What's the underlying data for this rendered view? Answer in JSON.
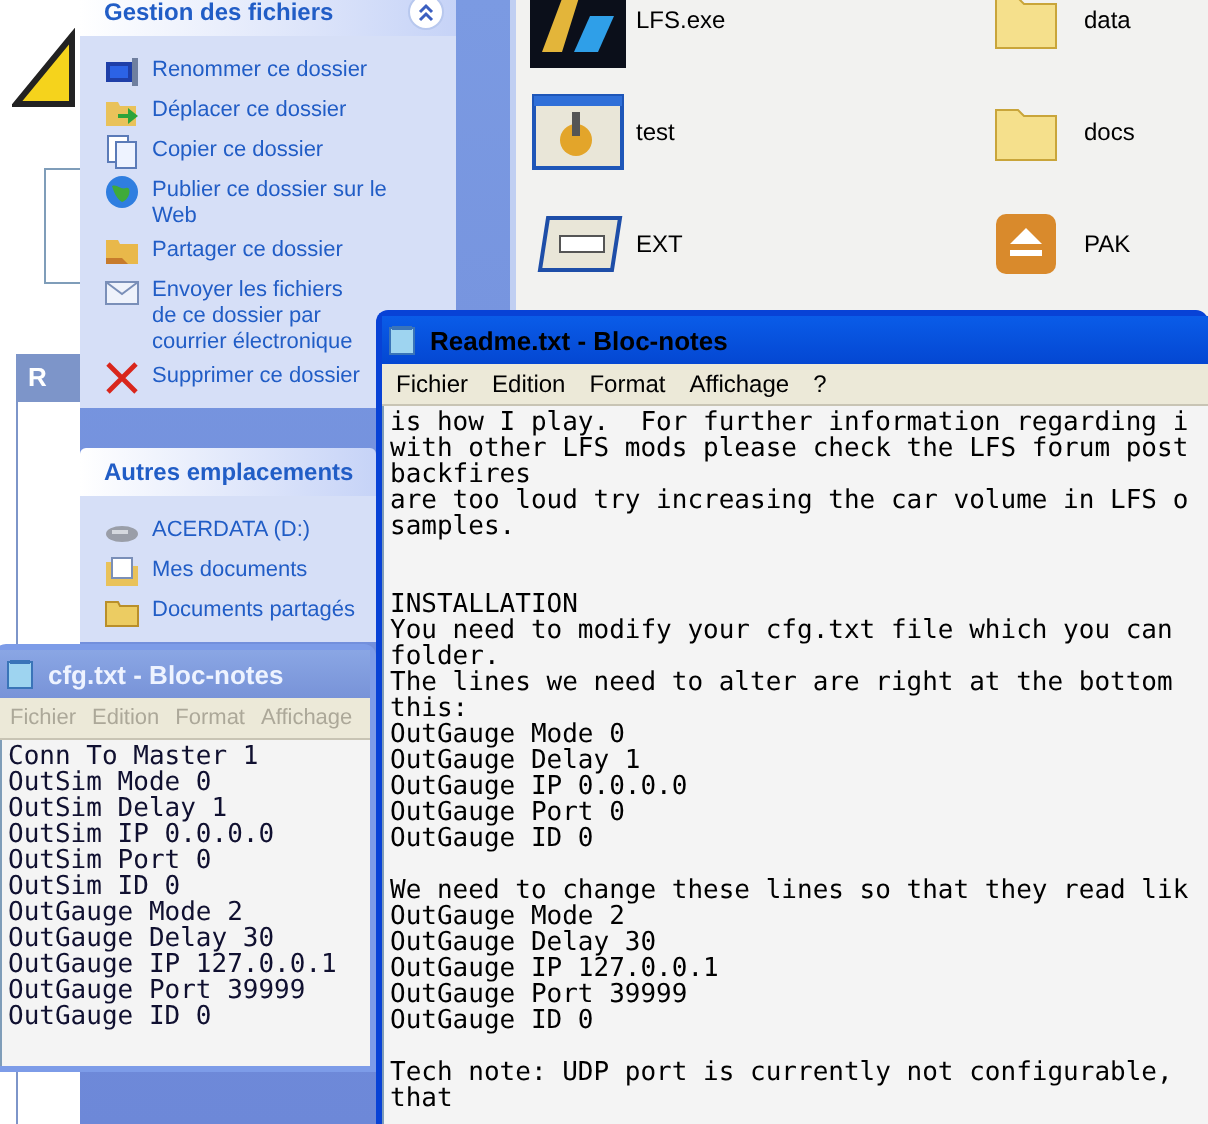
{
  "explorer": {
    "fragment_title": "R",
    "task_panels": [
      {
        "title": "Gestion des fichiers",
        "expanded": true,
        "items": [
          {
            "label": "Renommer ce dossier",
            "kind": "rename"
          },
          {
            "label": "Déplacer ce dossier",
            "kind": "move"
          },
          {
            "label": "Copier ce dossier",
            "kind": "copy"
          },
          {
            "label": "Publier ce dossier sur le Web",
            "kind": "publish"
          },
          {
            "label": "Partager ce dossier",
            "kind": "share"
          },
          {
            "label": "Envoyer les fichiers de ce dossier par courrier électronique",
            "kind": "email"
          },
          {
            "label": "Supprimer ce dossier",
            "kind": "delete"
          }
        ]
      },
      {
        "title": "Autres emplacements",
        "expanded": true,
        "items": [
          {
            "label": "ACERDATA (D:)",
            "kind": "drive"
          },
          {
            "label": "Mes documents",
            "kind": "documents"
          },
          {
            "label": "Documents partagés",
            "kind": "folder"
          }
        ]
      }
    ],
    "files": [
      {
        "name": "LFS.exe",
        "kind": "game"
      },
      {
        "name": "data",
        "kind": "folder"
      },
      {
        "name": "test",
        "kind": "settings"
      },
      {
        "name": "docs",
        "kind": "folder"
      },
      {
        "name": "EXT",
        "kind": "window"
      },
      {
        "name": "PAK",
        "kind": "archive"
      }
    ]
  },
  "windows": [
    {
      "title": "Readme.txt - Bloc-notes",
      "active": true,
      "menu": [
        "Fichier",
        "Edition",
        "Format",
        "Affichage",
        "?"
      ],
      "paragraphs": [
        "is how I play.  For further information regarding i\nwith other LFS mods please check the LFS forum post\nbackfires\nare too loud try increasing the car volume in LFS o\nsamples.",
        "\nINSTALLATION\nYou need to modify your cfg.txt file which you can\nfolder.\nThe lines we need to alter are right at the bottom\nthis:\nOutGauge Mode 0\nOutGauge Delay 1\nOutGauge IP 0.0.0.0\nOutGauge Port 0\nOutGauge ID 0",
        "We need to change these lines so that they read lik\nOutGauge Mode 2\nOutGauge Delay 30\nOutGauge IP 127.0.0.1\nOutGauge Port 39999\nOutGauge ID 0",
        "Tech note: UDP port is currently not configurable,\nthat"
      ]
    },
    {
      "title": "cfg.txt - Bloc-notes",
      "active": false,
      "menu": [
        "Fichier",
        "Edition",
        "Format",
        "Affichage"
      ],
      "paragraphs": [
        "Conn To Master 1\nOutSim Mode 0\nOutSim Delay 1\nOutSim IP 0.0.0.0\nOutSim Port 0\nOutSim ID 0\nOutGauge Mode 2\nOutGauge Delay 30\nOutGauge IP 127.0.0.1\nOutGauge Port 39999\nOutGauge ID 0"
      ]
    }
  ]
}
